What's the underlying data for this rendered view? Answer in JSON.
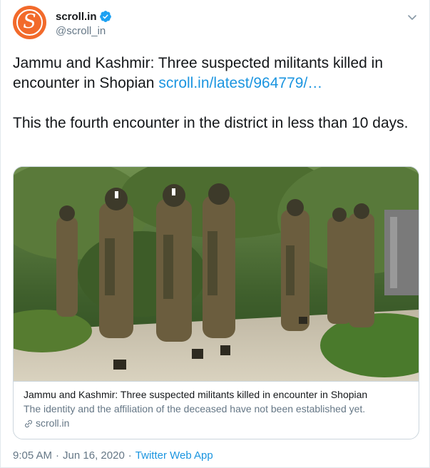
{
  "author": {
    "display_name": "scroll.in",
    "handle": "@scroll_in",
    "avatar_letter": "S",
    "avatar_color": "#f26a2b",
    "verified": true
  },
  "tweet": {
    "line1_text": "Jammu and Kashmir: Three suspected militants killed in encounter in Shopian ",
    "line1_link": "scroll.in/latest/964779/…",
    "line2_text": "This the fourth encounter in the district in less than 10 days."
  },
  "card": {
    "title": "Jammu and Kashmir: Three suspected militants killed in encounter in Shopian",
    "description": "The identity and the affiliation of the deceased have not been established yet.",
    "domain": "scroll.in"
  },
  "meta": {
    "time": "9:05 AM",
    "separator1": "·",
    "date": "Jun 16, 2020",
    "separator2": "·",
    "source": "Twitter Web App"
  },
  "colors": {
    "link": "#1b95e0",
    "muted": "#657786",
    "verified": "#1da1f2"
  }
}
